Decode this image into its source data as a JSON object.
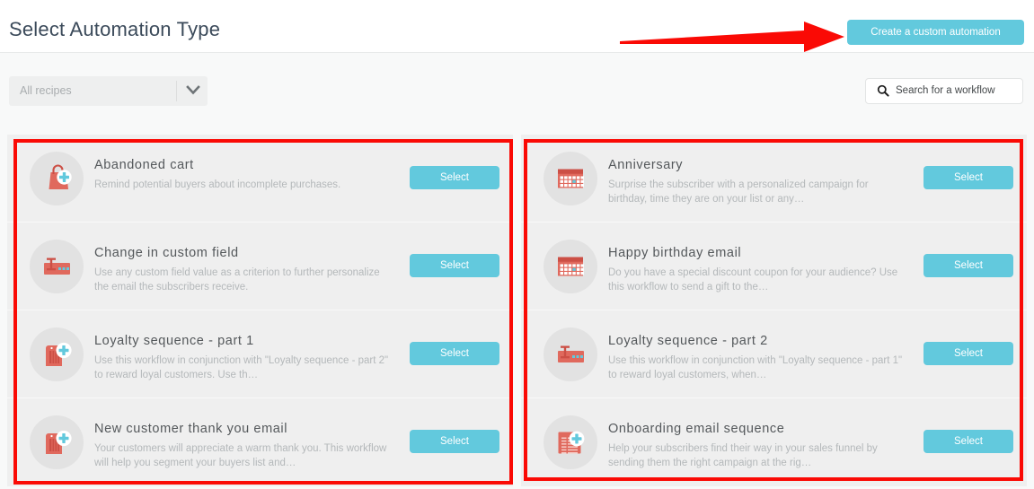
{
  "header": {
    "title": "Select Automation Type",
    "create_button_label": "Create a custom automation"
  },
  "filter_bar": {
    "recipes_select": {
      "value": "All recipes",
      "chevron_icon": "chevron-down-icon"
    },
    "search": {
      "icon": "search-icon",
      "placeholder": "Search for a workflow",
      "value": ""
    }
  },
  "annotations": {
    "arrow": {
      "shape": "red-arrow-pointing-right",
      "color": "#fa0a05",
      "target": "Create a custom automation"
    },
    "boxes": [
      {
        "name": "left-column-highlight",
        "color": "#fa0a05"
      },
      {
        "name": "right-column-highlight",
        "color": "#fa0a05"
      }
    ]
  },
  "colors": {
    "accent_cyan": "#62c9dd",
    "icon_salmon": "#e0695d",
    "icon_dark_red": "#cc4f45",
    "annotation_red": "#fa0a05",
    "title_text": "#3b4a5a",
    "card_bg": "#efefef"
  },
  "select_button_label": "Select",
  "columns": {
    "left": [
      {
        "title": "Abandoned cart",
        "description": "Remind potential buyers about incomplete purchases.",
        "icon": "shopping-bag-plus-icon",
        "button_label": "Select"
      },
      {
        "title": "Change in custom field",
        "description": "Use any custom field value as a criterion to further personalize the email the subscribers receive.",
        "icon": "custom-field-icon",
        "button_label": "Select"
      },
      {
        "title": "Loyalty sequence - part 1",
        "description": "Use this workflow in conjunction with \"Loyalty sequence - part 2\" to reward loyal customers. Use th…",
        "icon": "loyalty-tag-plus-icon",
        "button_label": "Select"
      },
      {
        "title": "New customer thank you email",
        "description": "Your customers will appreciate a warm thank you. This workflow will help you segment your buyers list and…",
        "icon": "loyalty-tag-plus-icon",
        "button_label": "Select"
      }
    ],
    "right": [
      {
        "title": "Anniversary",
        "description": "Surprise the subscriber with a personalized campaign for birthday, time they are on your list or any…",
        "icon": "calendar-icon",
        "button_label": "Select"
      },
      {
        "title": "Happy birthday email",
        "description": "Do you have a special discount coupon for your audience? Use this workflow to send a gift to the…",
        "icon": "calendar-icon",
        "button_label": "Select"
      },
      {
        "title": "Loyalty sequence - part 2",
        "description": "Use this workflow in conjunction with \"Loyalty sequence - part 1\" to reward loyal customers, when…",
        "icon": "custom-field-icon",
        "button_label": "Select"
      },
      {
        "title": "Onboarding email sequence",
        "description": "Help your subscribers find their way in your sales funnel by sending them the right campaign at the rig…",
        "icon": "document-plus-icon",
        "button_label": "Select"
      }
    ]
  }
}
